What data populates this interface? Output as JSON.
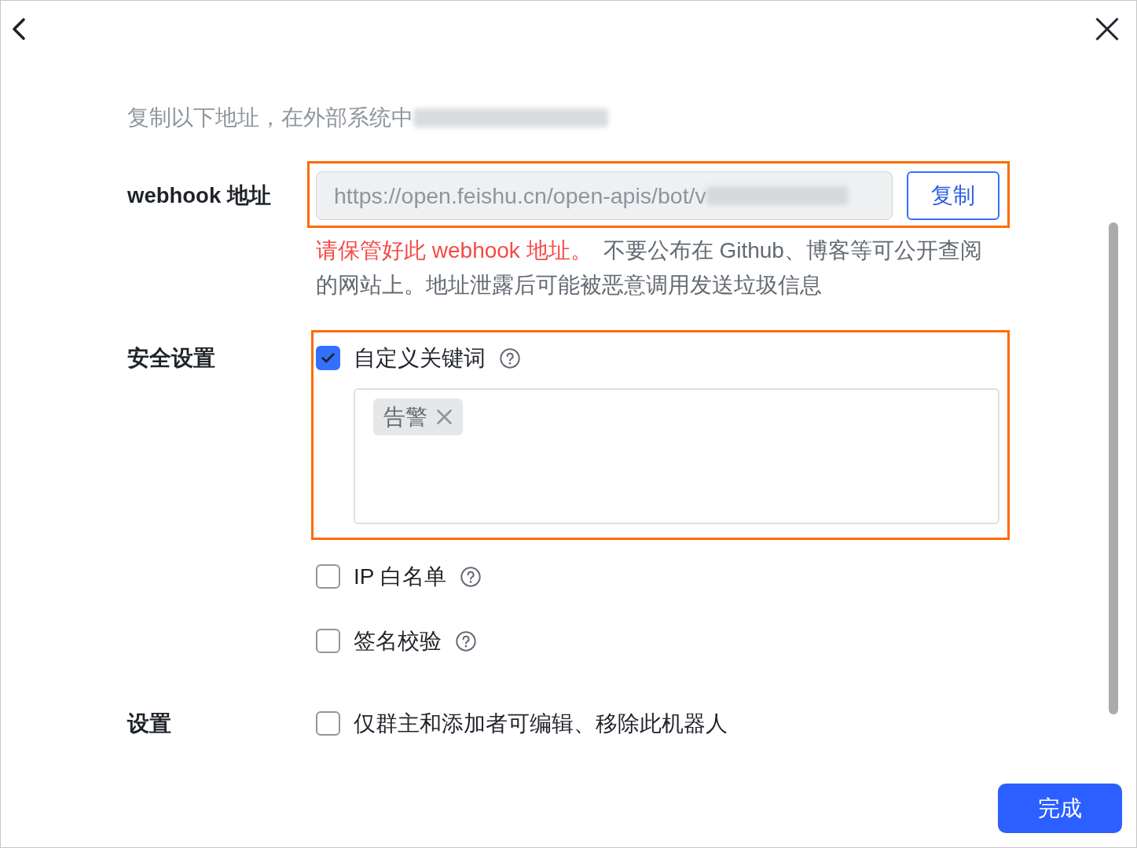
{
  "intro": {
    "text": "复制以下地址，在外部系统中",
    "redacted": true
  },
  "webhook": {
    "label": "webhook 地址",
    "highlighted": true,
    "url": {
      "value": "https://open.feishu.cn/open-apis/bot/v",
      "redacted": true
    },
    "copy_button": "复制",
    "warning": {
      "emphasis": "请保管好此 webhook 地址。",
      "text": "不要公布在 Github、博客等可公开查阅的网站上。地址泄露后可能被恶意调用发送垃圾信息"
    }
  },
  "security": {
    "label": "安全设置",
    "options": [
      {
        "label": "自定义关键词",
        "checked": true,
        "help": true,
        "highlighted": true,
        "keywords": [
          "告警"
        ]
      },
      {
        "label": "IP 白名单",
        "checked": false,
        "help": true
      },
      {
        "label": "签名校验",
        "checked": false,
        "help": true
      }
    ]
  },
  "settings": {
    "label": "设置",
    "options": [
      {
        "label": "仅群主和添加者可编辑、移除此机器人",
        "checked": false
      }
    ]
  },
  "done_button": "完成"
}
